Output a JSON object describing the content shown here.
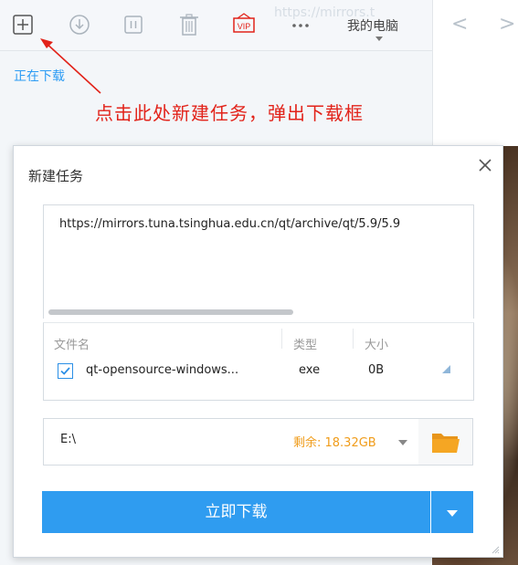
{
  "toolbar": {
    "buttons": [
      {
        "icon": "new-task-icon"
      },
      {
        "icon": "download-icon"
      },
      {
        "icon": "pause-icon"
      },
      {
        "icon": "trash-icon"
      },
      {
        "icon": "vip-icon",
        "label": "VIP"
      },
      {
        "icon": "more-icon",
        "label": "···"
      }
    ],
    "my_pc_label": "我的电脑",
    "address_ghost": "https://mirrors.t"
  },
  "sidebar": {
    "downloading_label": "正在下载"
  },
  "nav": {
    "back": "<",
    "forward": ">"
  },
  "annotation": {
    "text": "点击此处新建任务，弹出下载框",
    "color": "#e2231a"
  },
  "dialog": {
    "title": "新建任务",
    "url": "https://mirrors.tuna.tsinghua.edu.cn/qt/archive/qt/5.9/5.9",
    "columns": {
      "name": "文件名",
      "type": "类型",
      "size": "大小"
    },
    "file": {
      "checked": true,
      "name": "qt-opensource-windows...",
      "type": "exe",
      "size": "0B"
    },
    "save_path": "E:\\",
    "free_space": "剩余: 18.32GB",
    "download_button": "立即下载"
  },
  "colors": {
    "accent": "#2f9cf0",
    "free_space": "#f09c1a",
    "folder": "#f5a623"
  }
}
